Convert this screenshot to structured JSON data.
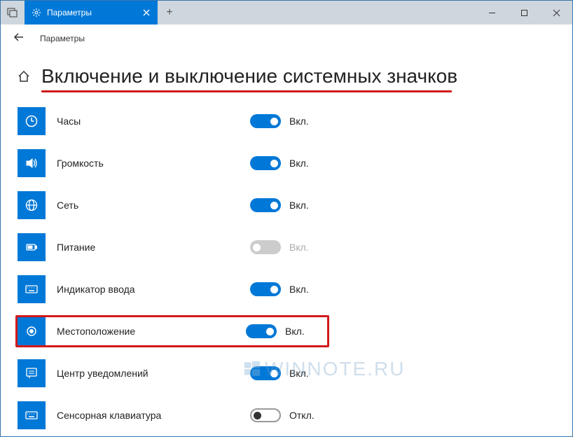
{
  "window": {
    "tab_title": "Параметры",
    "breadcrumb": "Параметры"
  },
  "page": {
    "title": "Включение и выключение системных значков"
  },
  "toggle_states": {
    "on_label": "Вкл.",
    "off_label": "Откл."
  },
  "settings": [
    {
      "key": "clock",
      "label": "Часы",
      "state": "on",
      "highlight": false
    },
    {
      "key": "volume",
      "label": "Громкость",
      "state": "on",
      "highlight": false
    },
    {
      "key": "network",
      "label": "Сеть",
      "state": "on",
      "highlight": false
    },
    {
      "key": "power",
      "label": "Питание",
      "state": "disabled",
      "highlight": false
    },
    {
      "key": "input",
      "label": "Индикатор ввода",
      "state": "on",
      "highlight": false
    },
    {
      "key": "location",
      "label": "Местоположение",
      "state": "on",
      "highlight": true
    },
    {
      "key": "actioncenter",
      "label": "Центр уведомлений",
      "state": "on",
      "highlight": false
    },
    {
      "key": "touchkb",
      "label": "Сенсорная клавиатура",
      "state": "off",
      "highlight": false
    }
  ],
  "watermark": "WINNOTE.RU"
}
